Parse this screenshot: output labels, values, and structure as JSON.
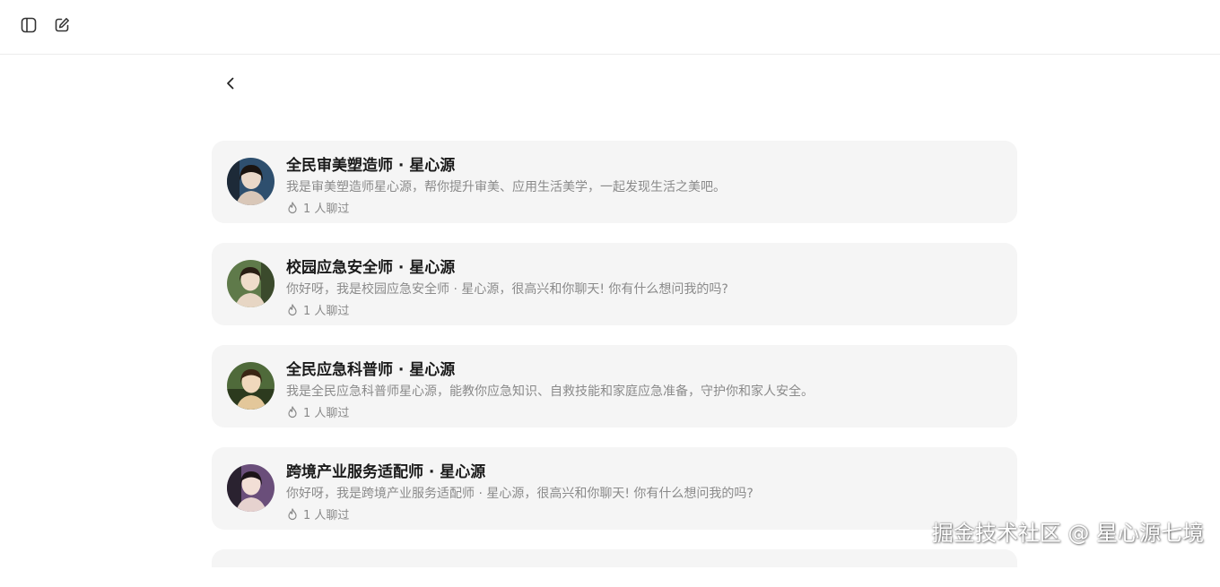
{
  "toolbar": {
    "sidebar_icon": "sidebar-toggle-icon",
    "newchat_icon": "edit-icon"
  },
  "back_icon": "chevron-left-icon",
  "agents": [
    {
      "title": "全民审美塑造师 · 星心源",
      "description": "我是审美塑造师星心源，帮你提升审美、应用生活美学，一起发现生活之美吧。",
      "chat_count": "1 人聊过",
      "avatar_colors": [
        "#2e4f6e",
        "#d9c7b8",
        "#1d2a38"
      ]
    },
    {
      "title": "校园应急安全师 · 星心源",
      "description": "你好呀，我是校园应急安全师 · 星心源，很高兴和你聊天! 你有什么想问我的吗?",
      "chat_count": "1 人聊过",
      "avatar_colors": [
        "#5f7a4a",
        "#e7d6c4",
        "#3b4a2c"
      ]
    },
    {
      "title": "全民应急科普师 · 星心源",
      "description": "我是全民应急科普师星心源，能教你应急知识、自救技能和家庭应急准备，守护你和家人安全。",
      "chat_count": "1 人聊过",
      "avatar_colors": [
        "#4f6a3a",
        "#e3c79a",
        "#2c3a1e"
      ]
    },
    {
      "title": "跨境产业服务适配师 · 星心源",
      "description": "你好呀，我是跨境产业服务适配师 · 星心源，很高兴和你聊天! 你有什么想问我的吗?",
      "chat_count": "1 人聊过",
      "avatar_colors": [
        "#6a4e7a",
        "#e6d2cf",
        "#2a2230"
      ]
    }
  ],
  "fire_icon": "fire-icon",
  "watermark": "掘金技术社区 @ 星心源七境"
}
